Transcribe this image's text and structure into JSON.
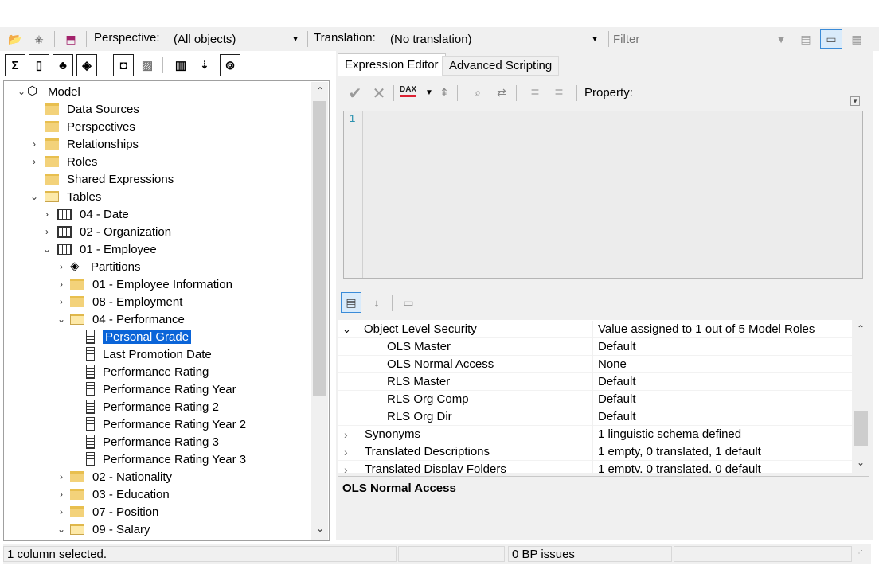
{
  "toolbar": {
    "perspective_label": "Perspective:",
    "perspective_value": "(All objects)",
    "translation_label": "Translation:",
    "translation_value": "(No translation)",
    "filter_placeholder": "Filter"
  },
  "tree": {
    "items": [
      {
        "label": "Model"
      },
      {
        "label": "Data Sources"
      },
      {
        "label": "Perspectives"
      },
      {
        "label": "Relationships"
      },
      {
        "label": "Roles"
      },
      {
        "label": "Shared Expressions"
      },
      {
        "label": "Tables"
      },
      {
        "label": "04 - Date"
      },
      {
        "label": "02 - Organization"
      },
      {
        "label": "01 - Employee"
      },
      {
        "label": "Partitions"
      },
      {
        "label": "01 - Employee Information"
      },
      {
        "label": "08 - Employment"
      },
      {
        "label": "04 - Performance"
      },
      {
        "label": "Personal Grade"
      },
      {
        "label": "Last Promotion Date"
      },
      {
        "label": "Performance Rating"
      },
      {
        "label": "Performance Rating Year"
      },
      {
        "label": "Performance Rating 2"
      },
      {
        "label": "Performance Rating Year 2"
      },
      {
        "label": "Performance Rating 3"
      },
      {
        "label": "Performance Rating Year 3"
      },
      {
        "label": "02 - Nationality"
      },
      {
        "label": "03 - Education"
      },
      {
        "label": "07 - Position"
      },
      {
        "label": "09 - Salary"
      }
    ]
  },
  "tabs": {
    "expression_editor": "Expression Editor",
    "advanced_scripting": "Advanced Scripting"
  },
  "editor": {
    "dax_label": "DAX",
    "property_label": "Property:",
    "line_number": "1"
  },
  "properties": {
    "rows": [
      {
        "name": "Object Level Security",
        "value": "Value assigned to 1 out of 5 Model Roles"
      },
      {
        "name": "OLS Master",
        "value": "Default"
      },
      {
        "name": "OLS Normal Access",
        "value": "None"
      },
      {
        "name": "RLS Master",
        "value": "Default"
      },
      {
        "name": "RLS Org Comp",
        "value": "Default"
      },
      {
        "name": "RLS Org Dir",
        "value": "Default"
      },
      {
        "name": "Synonyms",
        "value": "1 linguistic schema defined"
      },
      {
        "name": "Translated Descriptions",
        "value": "1 empty, 0 translated, 1 default"
      },
      {
        "name": "Translated Display Folders",
        "value": "1 empty, 0 translated, 0 default"
      }
    ],
    "description_title": "OLS Normal Access"
  },
  "status": {
    "selection": "1 column selected.",
    "bp_issues": "0 BP issues"
  },
  "colors": {
    "selection": "#0a64d8",
    "folder": "#f3d27a",
    "panel_bg": "#f0f0f0"
  }
}
